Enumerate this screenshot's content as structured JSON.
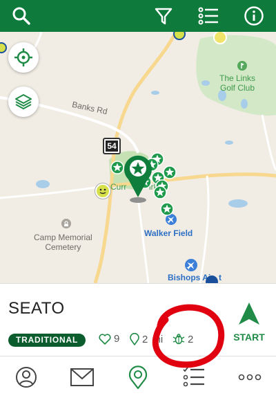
{
  "topbar": {
    "icons": [
      "search-icon",
      "filter-icon",
      "list-icon",
      "info-icon"
    ],
    "color": "#0e7a3c"
  },
  "map": {
    "road_label": "Banks Rd",
    "route_shield": "54",
    "golf_club": "The Links\nGolf Club",
    "golf_club_line1": "The Links",
    "golf_club_line2": "Golf Club",
    "partial_label": "Curr",
    "partial_label2": "irk",
    "cemetery_line1": "Camp Memorial",
    "cemetery_line2": "Cemetery",
    "airfield": "Walker Field",
    "airport": "Bishops Airport",
    "airport_visible": "Bishops Air",
    "airport_suffix": "t"
  },
  "card": {
    "cache_name": "SEATO",
    "type": "TRADITIONAL",
    "favorites": "9",
    "distance": "2",
    "distance_suffix": "mi",
    "bugs": "2",
    "start_label": "START",
    "accent": "#1f8b46"
  },
  "bottom_nav": {
    "tabs": [
      "profile-icon",
      "message-icon",
      "map-pin-icon",
      "list-check-icon",
      "more-icon"
    ],
    "active": "map-pin-icon"
  }
}
